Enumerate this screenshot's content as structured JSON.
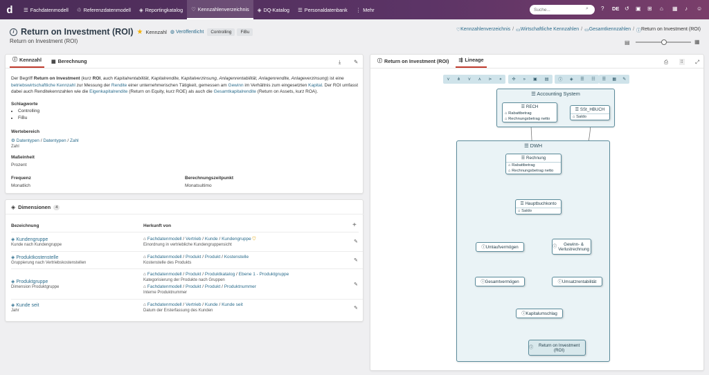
{
  "nav": {
    "logo": "d",
    "items": [
      {
        "label": "Fachdatenmodell",
        "icon": "☰"
      },
      {
        "label": "Referenzdatenmodell",
        "icon": "♲"
      },
      {
        "label": "Reportingkatalog",
        "icon": "◈"
      },
      {
        "label": "Kennzahlenverzeichnis",
        "icon": "♡"
      },
      {
        "label": "DQ-Katalog",
        "icon": "◈"
      },
      {
        "label": "Personaldatenbank",
        "icon": "☰"
      },
      {
        "label": "Mehr",
        "icon": "⋮"
      }
    ],
    "active_index": 3,
    "search_placeholder": "Suche...",
    "language": "DE"
  },
  "header": {
    "title": "Return on Investment (ROI)",
    "type": "Kennzahl",
    "status": "Veröffentlicht",
    "tags": [
      "Controlling",
      "FiBu"
    ],
    "subtitle": "Return on Investment (ROI)",
    "breadcrumb": [
      "Kennzahlenverzeichnis",
      "Wirtschaftliche Kennzahlen",
      "Gesamtkennzahlen",
      "Return on Investment (ROI)"
    ]
  },
  "detail": {
    "tabs": [
      "Kennzahl",
      "Berechnung"
    ],
    "description": {
      "p1": "Der Begriff ",
      "b1": "Return on Investment",
      "p2": " (kurz ",
      "b2": "ROI",
      "p3": ", auch ",
      "i1": "Kapitalrentabilität, Kapitalrendite, Kapitalverzinsung, Anlagenrentabilität, Anlagenrendite, Anlageverzinsung",
      "p4": ") ist eine ",
      "l1": "betriebswirtschaftliche Kennzahl",
      "p5": " zur Messung der ",
      "l2": "Rendite",
      "p6": " einer unternehmerischen Tätigkeit, gemessen am ",
      "l3": "Gewinn",
      "p7": " im Verhältnis zum eingesetzten ",
      "l4": "Kapital",
      "p8": ". Der ROI umfasst dabei auch Renditekennzahlen wie die ",
      "l5": "Eigenkapitalrendite",
      "p9": " (Return on Equity, kurz ROE) als auch die ",
      "l6": "Gesamtkapitalrendite",
      "p10": " (Return on Assets, kurz ROA)."
    },
    "schlagworte_label": "Schlagworte",
    "schlagworte": [
      "Controlling",
      "FiBu"
    ],
    "wertebereich_label": "Wertebereich",
    "wertebereich_path": [
      "Datentypen",
      "Datentypen",
      "Zahl"
    ],
    "wertebereich_value": "Zahl",
    "masseinheit_label": "Maßeinheit",
    "masseinheit": "Prozent",
    "frequenz_label": "Frequenz",
    "frequenz": "Monatlich",
    "berechnungszeitpunkt_label": "Berechnungszeitpunkt",
    "berechnungszeitpunkt": "Monatsultimo"
  },
  "dimensions": {
    "title": "Dimensionen",
    "count": "4",
    "col1": "Bezeichnung",
    "col2": "Herkunft von",
    "rows": [
      {
        "name": "Kundengruppe",
        "desc": "Kunde nach Kundengruppe",
        "origins": [
          {
            "path": [
              "Fachdatenmodell",
              "Vertrieb",
              "Kunde",
              "Kundengruppe"
            ],
            "desc": "Einordnung in vertriebliche Kundengruppensicht"
          }
        ]
      },
      {
        "name": "Produktkostenstelle",
        "desc": "Gruppierung nach Vertriebskostenstellen",
        "origins": [
          {
            "path": [
              "Fachdatenmodell",
              "Produkt",
              "Produkt",
              "Kostenstelle"
            ],
            "desc": "Kostenstelle des Produkts"
          }
        ]
      },
      {
        "name": "Produktgruppe",
        "desc": "Dimension Produktgruppe",
        "origins": [
          {
            "path": [
              "Fachdatenmodell",
              "Produkt",
              "Produktkatalog",
              "Ebene 1 - Produktgruppe"
            ],
            "desc": "Kategorisierung der Produkte nach Gruppen"
          },
          {
            "path": [
              "Fachdatenmodell",
              "Produkt",
              "Produkt",
              "Produktnummer"
            ],
            "desc": "Interne Produktnummer"
          }
        ]
      },
      {
        "name": "Kunde seit",
        "desc": "Jahr",
        "origins": [
          {
            "path": [
              "Fachdatenmodell",
              "Vertrieb",
              "Kunde",
              "Kunde seit"
            ],
            "desc": "Datum der Ersterfassung des Kunden"
          }
        ]
      }
    ]
  },
  "lineage": {
    "tabs": [
      "Return on Investment (ROI)",
      "Lineage"
    ],
    "groups": {
      "accounting": "Accounting System",
      "dwh": "DWH"
    },
    "nodes": {
      "rech": {
        "title": "RECH",
        "attrs": [
          "Rabattbetrag",
          "Rechnungsbetrag netto"
        ]
      },
      "sst": {
        "title": "SSt_HBUCH",
        "attrs": [
          "Saldo"
        ]
      },
      "rechnung": {
        "title": "Rechnung",
        "attrs": [
          "Rabattbetrag",
          "Rechnungsbetrag netto"
        ]
      },
      "hauptbuch": {
        "title": "Hauptbuchkonto",
        "attrs": [
          "Saldo"
        ]
      },
      "umlauf": "Umlaufvermögen",
      "gewinn": "Gewinn- & Verlustrechnung",
      "gesamt": "Gesamtvermögen",
      "umsatz": "Umsatzrentabilität",
      "kapital": "Kapitalumschlag",
      "roi": "Return on Investment (ROI)"
    }
  }
}
